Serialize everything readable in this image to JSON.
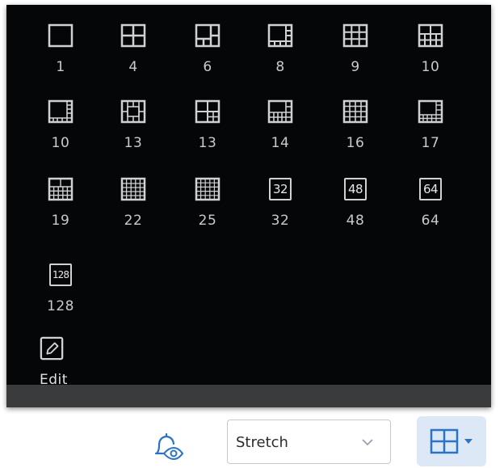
{
  "layout_popup": {
    "layouts": [
      {
        "label": "1",
        "icon": "single-view-icon"
      },
      {
        "label": "4",
        "icon": "grid-2x2-icon"
      },
      {
        "label": "6",
        "icon": "layout-6-icon"
      },
      {
        "label": "8",
        "icon": "layout-8-icon"
      },
      {
        "label": "9",
        "icon": "grid-3x3-icon"
      },
      {
        "label": "10",
        "icon": "layout-10-icon"
      },
      {
        "label": "10",
        "icon": "layout-10-alt-icon"
      },
      {
        "label": "13",
        "icon": "layout-13-icon"
      },
      {
        "label": "13",
        "icon": "layout-13-alt-icon"
      },
      {
        "label": "14",
        "icon": "layout-14-icon"
      },
      {
        "label": "16",
        "icon": "grid-4x4-icon"
      },
      {
        "label": "17",
        "icon": "layout-17-icon"
      },
      {
        "label": "19",
        "icon": "layout-19-icon"
      },
      {
        "label": "22",
        "icon": "layout-22-icon"
      },
      {
        "label": "25",
        "icon": "grid-5x5-icon"
      },
      {
        "label": "32",
        "icon": "layout-32-icon",
        "box_text": "32"
      },
      {
        "label": "48",
        "icon": "layout-48-icon",
        "box_text": "48"
      },
      {
        "label": "64",
        "icon": "layout-64-icon",
        "box_text": "64"
      },
      {
        "label": "128",
        "icon": "layout-128-icon",
        "box_text": "128"
      }
    ],
    "edit": {
      "label": "Edit",
      "icon": "pencil-icon"
    }
  },
  "toolbar": {
    "alarm_icon": "alarm-bell-eye-icon",
    "stretch_select": {
      "value": "Stretch",
      "icon": "chevron-down-icon"
    },
    "layout_button": {
      "icon": "grid-2x2-icon",
      "dropdown_icon": "caret-down-icon"
    }
  },
  "colors": {
    "popup_bg": "#050608",
    "icon_stroke": "#d0d1d3",
    "label": "#c9cacc",
    "accent": "#2b73c6",
    "layout_button_bg": "#dde8f6"
  }
}
